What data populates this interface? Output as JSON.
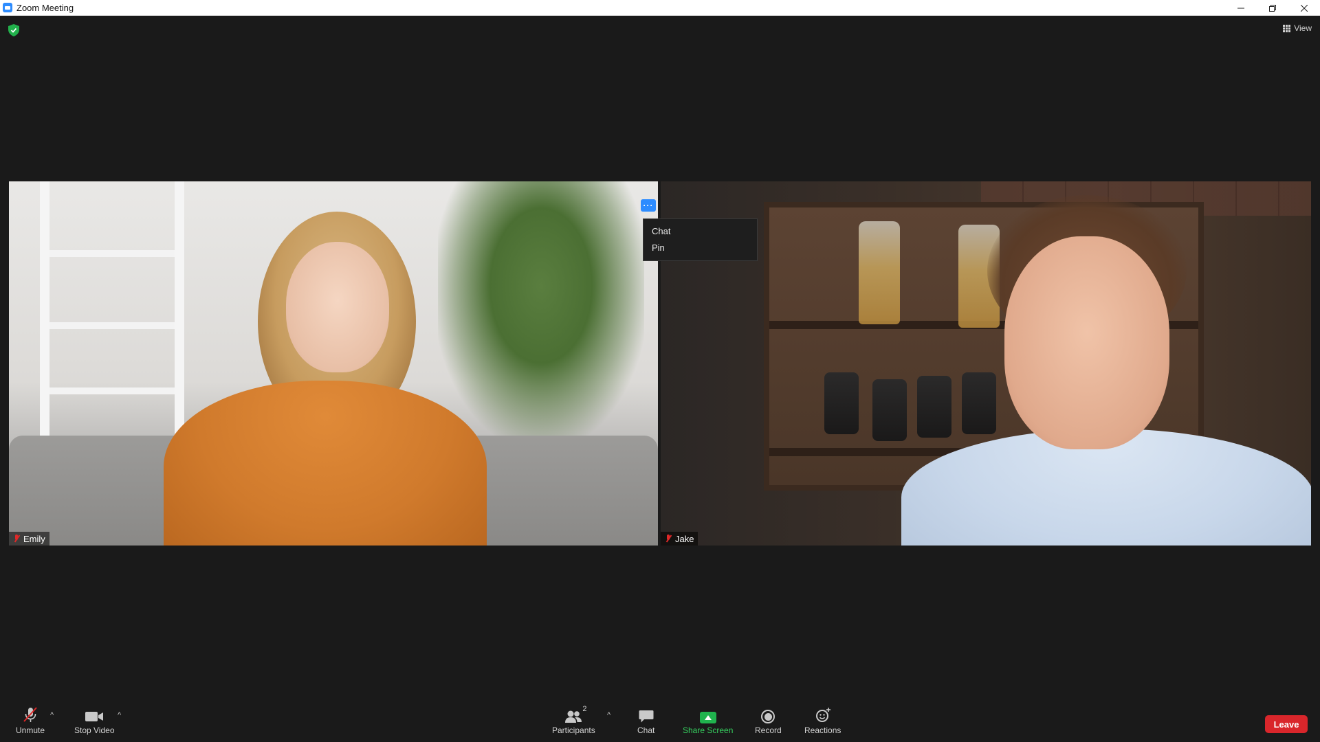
{
  "window": {
    "title": "Zoom Meeting",
    "controls": [
      "minimize",
      "restore",
      "close"
    ]
  },
  "header": {
    "view_label": "View"
  },
  "participants": [
    {
      "name": "Emily",
      "muted": true
    },
    {
      "name": "Jake",
      "muted": true
    }
  ],
  "context_menu": {
    "items": [
      "Chat",
      "Pin"
    ]
  },
  "toolbar": {
    "unmute_label": "Unmute",
    "stop_video_label": "Stop Video",
    "participants_label": "Participants",
    "participants_count": "2",
    "chat_label": "Chat",
    "share_label": "Share Screen",
    "record_label": "Record",
    "reactions_label": "Reactions",
    "leave_label": "Leave"
  },
  "colors": {
    "accent": "#2d8cff",
    "share_green": "#20b34e",
    "leave_red": "#d9262b",
    "background": "#1a1a1a"
  }
}
